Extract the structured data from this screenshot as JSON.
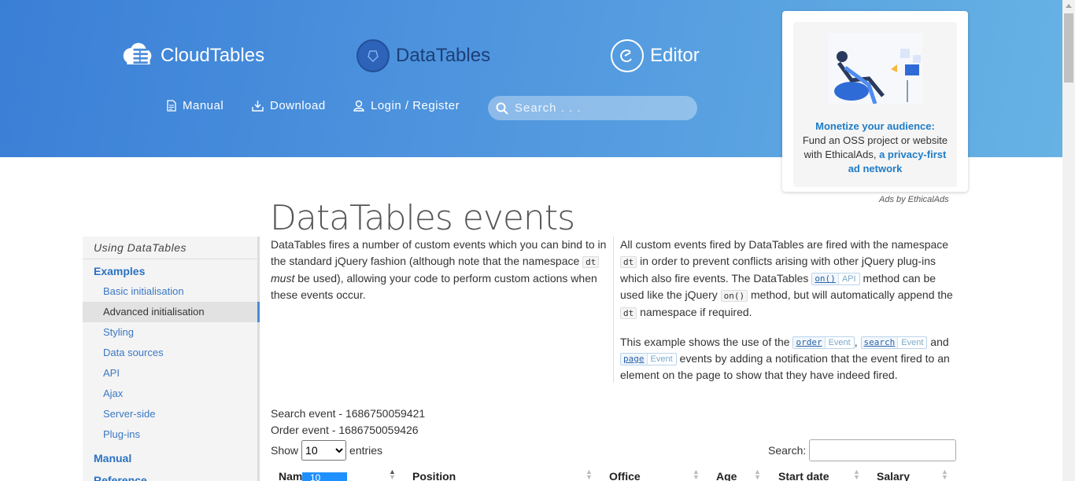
{
  "header": {
    "brands": [
      {
        "name": "CloudTables"
      },
      {
        "name": "DataTables"
      },
      {
        "name": "Editor"
      }
    ],
    "nav": [
      {
        "label": "Manual",
        "icon": "document-icon"
      },
      {
        "label": "Download",
        "icon": "download-icon"
      },
      {
        "label": "Login / Register",
        "icon": "user-icon"
      }
    ],
    "search": {
      "placeholder": "Search . . ."
    }
  },
  "ad": {
    "headline": "Monetize your audience:",
    "body": "Fund an OSS project or website with EthicalAds,",
    "link": "a privacy-first ad network",
    "by": "Ads by EthicalAds"
  },
  "page": {
    "title": "DataTables events"
  },
  "sidebar": {
    "heading": "Using DataTables",
    "sections": [
      {
        "label": "Examples"
      },
      {
        "label": "Manual"
      },
      {
        "label": "Reference"
      }
    ],
    "items": [
      {
        "label": "Basic initialisation"
      },
      {
        "label": "Advanced initialisation"
      },
      {
        "label": "Styling"
      },
      {
        "label": "Data sources"
      },
      {
        "label": "API"
      },
      {
        "label": "Ajax"
      },
      {
        "label": "Server-side"
      },
      {
        "label": "Plug-ins"
      }
    ]
  },
  "intro": {
    "p1_a": "DataTables fires a number of custom events which you can bind to in the standard jQuery fashion (although note that the namespace",
    "p1_code": "dt",
    "p1_em": "must",
    "p1_b": "be used), allowing your code to perform custom actions when these events occur.",
    "p2_a": "All custom events fired by DataTables are fired with the namespace",
    "p2_code1": "dt",
    "p2_b": "in order to prevent conflicts arising with other jQuery plug-ins which also fire events. The DataTables",
    "p2_api": "on()",
    "p2_api_kind": "API",
    "p2_c": "method can be used like the jQuery",
    "p2_code2": "on()",
    "p2_d": "method, but will automatically append the",
    "p2_code3": "dt",
    "p2_e": "namespace if required.",
    "p3_a": "This example shows the use of the",
    "ev1": "order",
    "ev2": "search",
    "ev3": "page",
    "ev_kind": "Event",
    "p3_b": "and",
    "p3_c": "events by adding a notification that the event fired to an element on the page to show that they have indeed fired."
  },
  "events": {
    "search": "Search event - 1686750059421",
    "order": "Order event - 1686750059426"
  },
  "table": {
    "show_label": "Show",
    "entries_label": "entries",
    "length_value": "10",
    "length_options": [
      "10"
    ],
    "search_label": "Search:",
    "columns": [
      "Name",
      "Position",
      "Office",
      "Age",
      "Start date",
      "Salary"
    ]
  }
}
